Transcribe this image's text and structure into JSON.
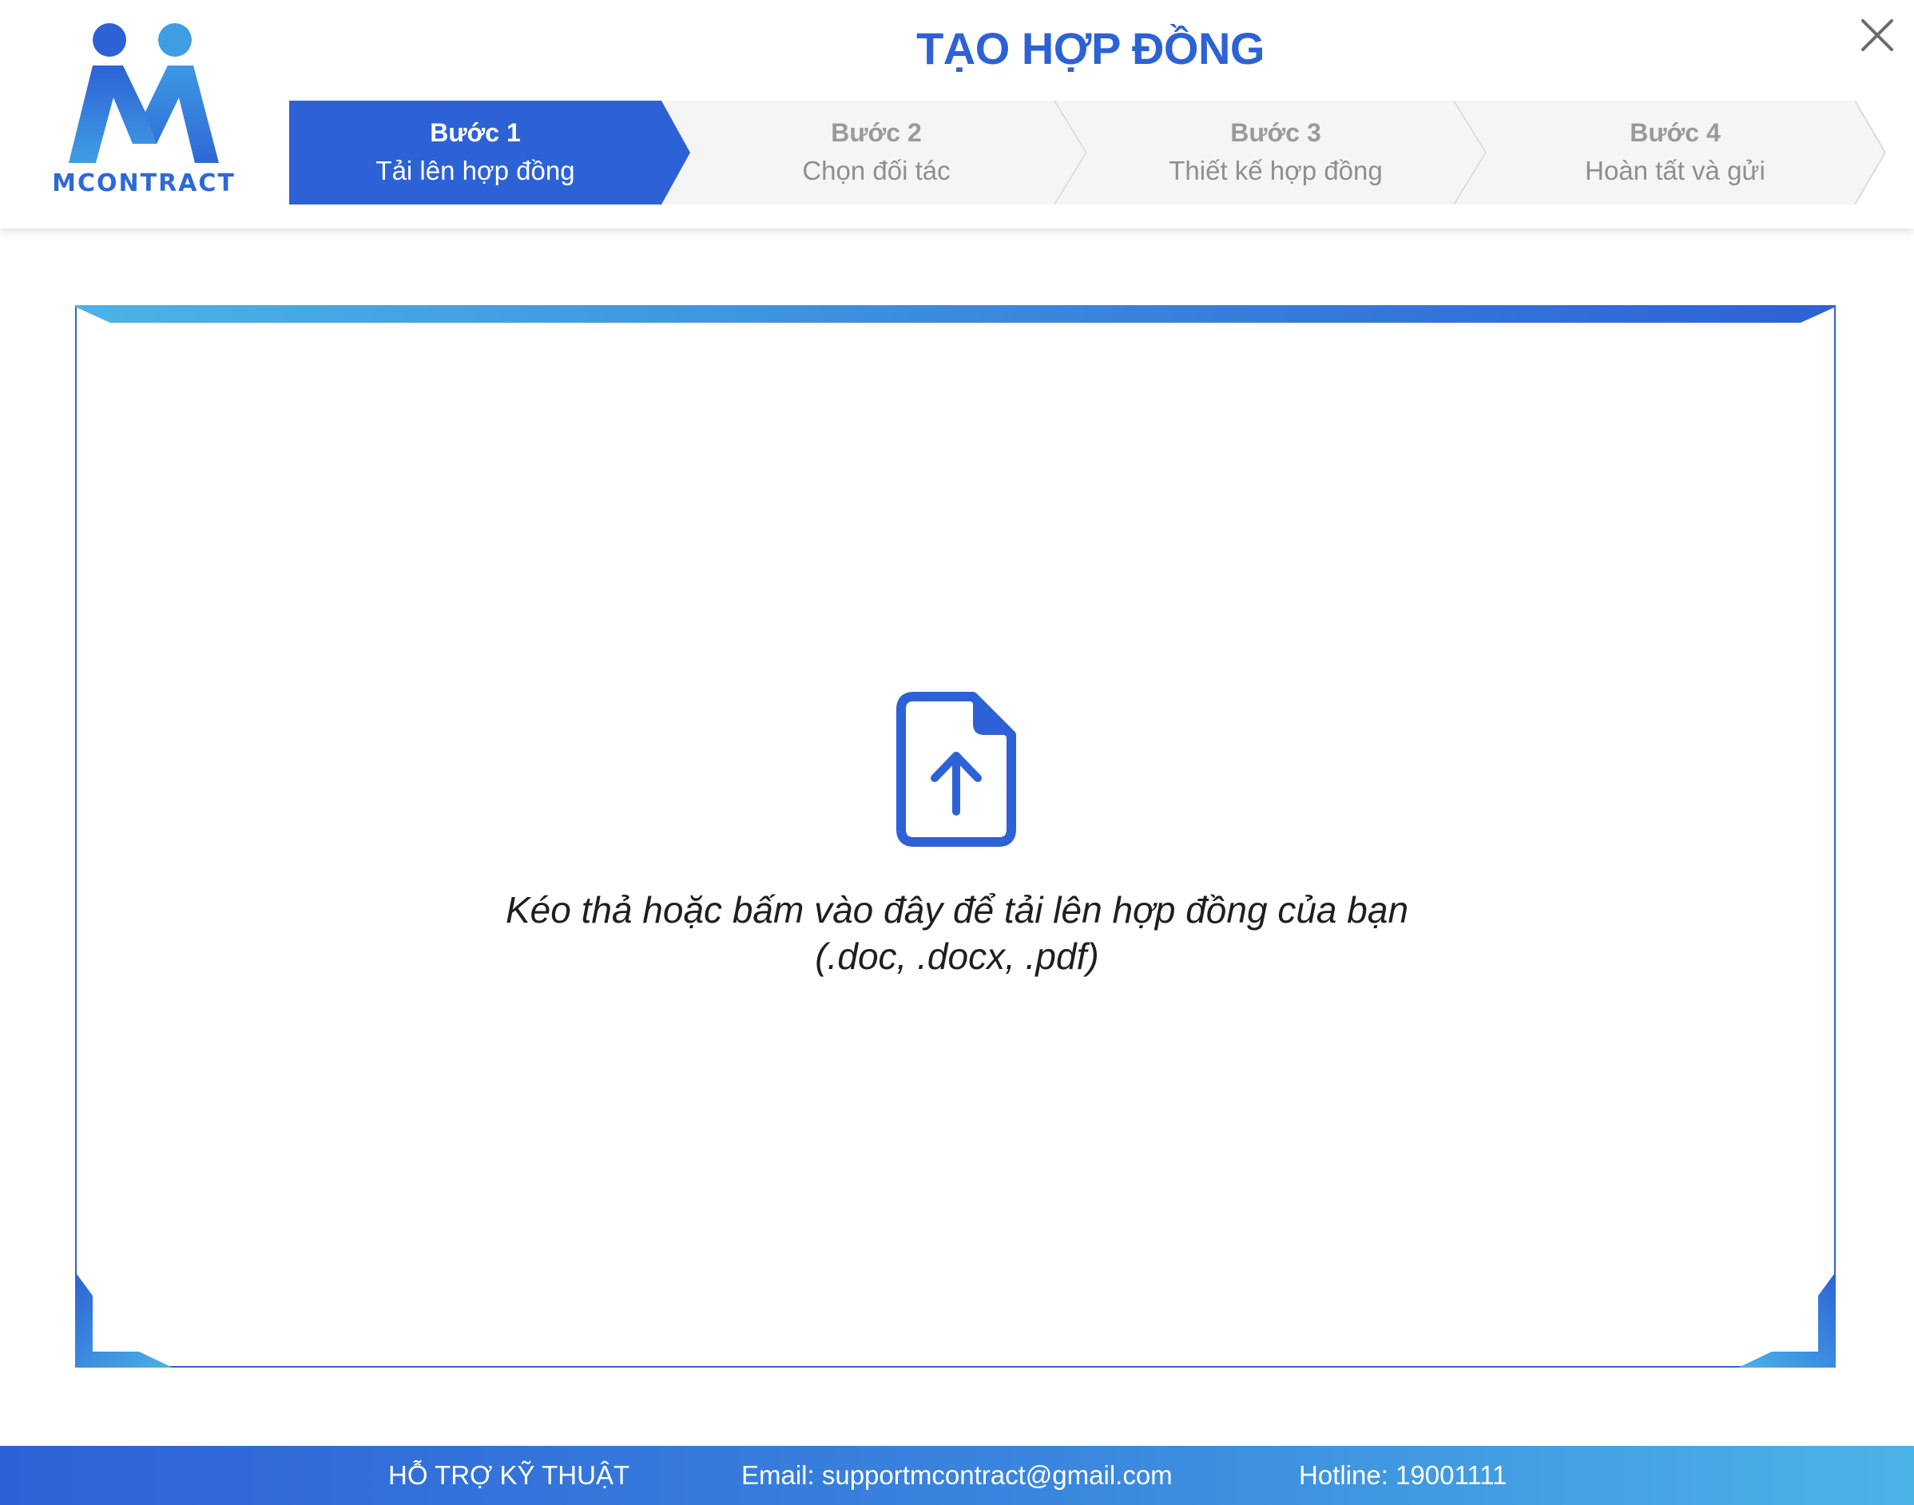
{
  "app": {
    "logo_text": "MCONTRACT",
    "title": "TẠO HỢP ĐỒNG",
    "close_icon": "close-icon"
  },
  "stepper": {
    "active_step": 1,
    "steps": [
      {
        "number": "Bước 1",
        "label": "Tải lên hợp đồng"
      },
      {
        "number": "Bước 2",
        "label": "Chọn đối tác"
      },
      {
        "number": "Bước 3",
        "label": "Thiết kế hợp đồng"
      },
      {
        "number": "Bước 4",
        "label": "Hoàn tất và gửi"
      }
    ]
  },
  "upload": {
    "icon": "file-upload-icon",
    "instruction": "Kéo thả hoặc bấm vào đây để tải lên hợp đồng của bạn",
    "formats": "(.doc, .docx, .pdf)"
  },
  "footer": {
    "support_label": "HỖ TRỢ KỸ THUẬT",
    "email": "Email: supportmcontract@gmail.com",
    "hotline": "Hotline: 19001111"
  },
  "colors": {
    "primary": "#2d62d6",
    "accent_light": "#4ab3e6",
    "step_inactive_bg": "#f5f5f5",
    "step_inactive_text": "#8f8f8f"
  }
}
